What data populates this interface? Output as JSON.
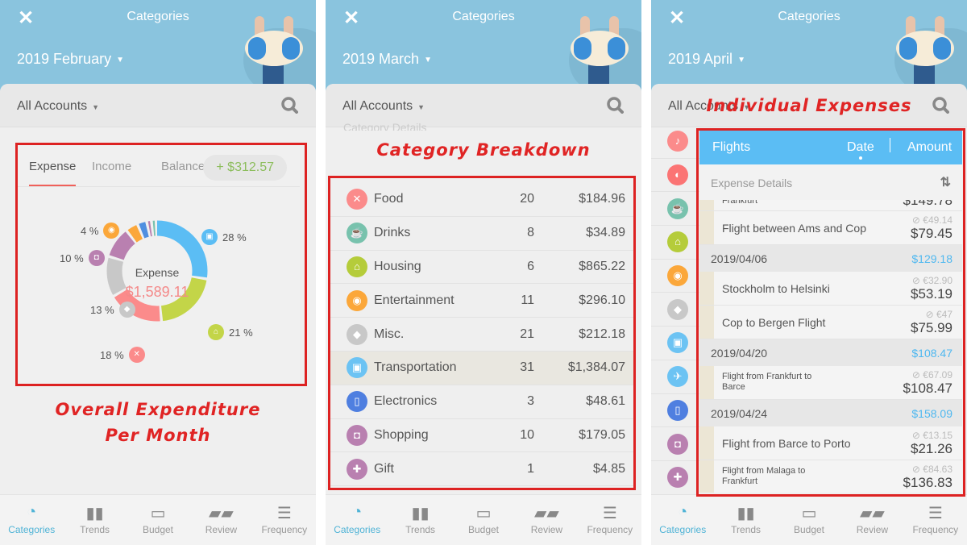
{
  "common": {
    "title": "Categories",
    "accounts": "All Accounts",
    "nav": [
      {
        "label": "Categories",
        "icon": "donut-icon"
      },
      {
        "label": "Trends",
        "icon": "bar-chart-icon"
      },
      {
        "label": "Budget",
        "icon": "battery-icon"
      },
      {
        "label": "Review",
        "icon": "cards-icon"
      },
      {
        "label": "Frequency",
        "icon": "list-icon"
      }
    ]
  },
  "panel1": {
    "month": "2019 February",
    "tabs": [
      "Expense",
      "Income",
      "Balance"
    ],
    "balance": "+ $312.57",
    "center_label": "Expense",
    "center_value": "$1,589.11",
    "annotation": [
      "Overall Expenditure",
      "Per Month"
    ]
  },
  "chart_data": {
    "type": "pie",
    "title": "Expense",
    "total": "$1,589.11",
    "slices": [
      {
        "category": "Transportation",
        "percent": 28,
        "label": "28 %",
        "color": "#5bbdf4"
      },
      {
        "category": "Housing",
        "percent": 21,
        "label": "21 %",
        "color": "#c3d548"
      },
      {
        "category": "Food",
        "percent": 18,
        "label": "18 %",
        "color": "#fb8b8b"
      },
      {
        "category": "Misc.",
        "percent": 13,
        "label": "13 %",
        "color": "#c8c8c8"
      },
      {
        "category": "Shopping",
        "percent": 10,
        "label": "10 %",
        "color": "#b980b0"
      },
      {
        "category": "Entertainment",
        "percent": 4,
        "label": "4 %",
        "color": "#fba73a"
      },
      {
        "category": "Electronics",
        "percent": 3,
        "label": "",
        "color": "#4f8fe0"
      },
      {
        "category": "Gift",
        "percent": 1.5,
        "label": "",
        "color": "#b980b0"
      },
      {
        "category": "Drinks",
        "percent": 1.5,
        "label": "",
        "color": "#78c2ad"
      }
    ]
  },
  "panel2": {
    "month": "2019 March",
    "faded_header": "Category Details",
    "annotation": "Category Breakdown",
    "rows": [
      {
        "name": "Food",
        "count": "20",
        "amount": "$184.96",
        "color": "#fb8b8b",
        "icon": "utensils-icon",
        "glyph": "✕"
      },
      {
        "name": "Drinks",
        "count": "8",
        "amount": "$34.89",
        "color": "#78c2ad",
        "icon": "cup-icon",
        "glyph": "☕"
      },
      {
        "name": "Housing",
        "count": "6",
        "amount": "$865.22",
        "color": "#b5cc3a",
        "icon": "house-icon",
        "glyph": "⌂"
      },
      {
        "name": "Entertainment",
        "count": "11",
        "amount": "$296.10",
        "color": "#fba73a",
        "icon": "gamepad-icon",
        "glyph": "◉"
      },
      {
        "name": "Misc.",
        "count": "21",
        "amount": "$212.18",
        "color": "#c8c8c8",
        "icon": "tag-icon",
        "glyph": "◆"
      },
      {
        "name": "Transportation",
        "count": "31",
        "amount": "$1,384.07",
        "color": "#6cc3f3",
        "icon": "bus-icon",
        "glyph": "▣"
      },
      {
        "name": "Electronics",
        "count": "3",
        "amount": "$48.61",
        "color": "#4f7fe0",
        "icon": "phone-icon",
        "glyph": "▯"
      },
      {
        "name": "Shopping",
        "count": "10",
        "amount": "$179.05",
        "color": "#b980b0",
        "icon": "bag-icon",
        "glyph": "◘"
      },
      {
        "name": "Gift",
        "count": "1",
        "amount": "$4.85",
        "color": "#b980b0",
        "icon": "gift-icon",
        "glyph": "✚"
      }
    ]
  },
  "panel3": {
    "month": "2019 April",
    "annotation": "Individual Expenses",
    "side_icons": [
      {
        "icon": "bell-icon",
        "color": "#fb8b8b",
        "glyph": "♪"
      },
      {
        "icon": "bread-icon",
        "color": "#fb7474",
        "glyph": "◐"
      },
      {
        "icon": "cup-icon",
        "color": "#78c2ad",
        "glyph": "☕"
      },
      {
        "icon": "house-icon",
        "color": "#b5cc3a",
        "glyph": "⌂"
      },
      {
        "icon": "gamepad-icon",
        "color": "#fba73a",
        "glyph": "◉"
      },
      {
        "icon": "tag-icon",
        "color": "#c8c8c8",
        "glyph": "◆"
      },
      {
        "icon": "bus-icon",
        "color": "#6cc3f3",
        "glyph": "▣"
      },
      {
        "icon": "plane-icon",
        "color": "#6cc3f3",
        "glyph": "✈"
      },
      {
        "icon": "phone-icon",
        "color": "#4f7fe0",
        "glyph": "▯"
      },
      {
        "icon": "bag-icon",
        "color": "#b980b0",
        "glyph": "◘"
      },
      {
        "icon": "gift-icon",
        "color": "#b980b0",
        "glyph": "✚"
      }
    ],
    "detail_title": "Flights",
    "sort_date": "Date",
    "sort_amount": "Amount",
    "section": "Expense Details",
    "partial_entry": {
      "name": "Frankfurt",
      "amount": "$149.78"
    },
    "groups": [
      {
        "date": "",
        "total": "",
        "entries": [
          {
            "name": "Flight between Ams and Cop",
            "orig": "€49.14",
            "amount": "$79.45"
          }
        ]
      },
      {
        "date": "2019/04/06",
        "total": "$129.18",
        "entries": [
          {
            "name": "Stockholm to Helsinki",
            "orig": "€32.90",
            "amount": "$53.19"
          },
          {
            "name": "Cop to Bergen Flight",
            "orig": "€47",
            "amount": "$75.99"
          }
        ]
      },
      {
        "date": "2019/04/20",
        "total": "$108.47",
        "entries": [
          {
            "name": "Flight from Frankfurt to Barce",
            "orig": "€67.09",
            "amount": "$108.47"
          }
        ]
      },
      {
        "date": "2019/04/24",
        "total": "$158.09",
        "entries": [
          {
            "name": "Flight from Barce to Porto",
            "orig": "€13.15",
            "amount": "$21.26"
          },
          {
            "name": "Flight from Malaga to Frankfurt",
            "orig": "€84.63",
            "amount": "$136.83"
          }
        ]
      }
    ]
  }
}
